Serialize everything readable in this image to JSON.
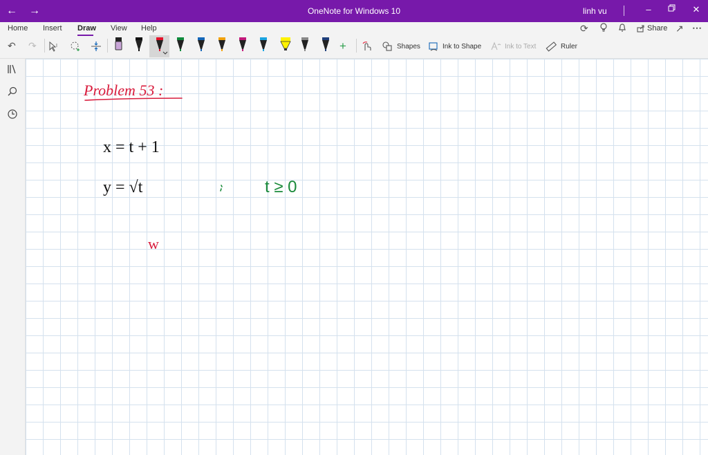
{
  "titlebar": {
    "title": "OneNote for Windows 10",
    "user": "linh vu",
    "back_icon": "arrow-left",
    "forward_icon": "arrow-right",
    "controls": [
      "minimize",
      "restore",
      "close"
    ],
    "color": "#7719aa"
  },
  "ribbon": {
    "tabs": [
      {
        "label": "Home"
      },
      {
        "label": "Insert"
      },
      {
        "label": "Draw",
        "active": true
      },
      {
        "label": "View"
      },
      {
        "label": "Help"
      }
    ],
    "share_label": "Share",
    "tools": {
      "shapes_label": "Shapes",
      "ink_to_shape_label": "Ink to Shape",
      "ink_to_text_label": "Ink to Text",
      "ruler_label": "Ruler"
    },
    "pens": [
      {
        "name": "eraser",
        "color": "#c9a6d8"
      },
      {
        "name": "pen-black",
        "color": "#111111"
      },
      {
        "name": "pen-red",
        "color": "#e3122b",
        "selected": true
      },
      {
        "name": "pen-green",
        "color": "#0f8a3c"
      },
      {
        "name": "pen-blue",
        "color": "#1466b8"
      },
      {
        "name": "pen-orange",
        "color": "#f2a20c"
      },
      {
        "name": "pen-magenta",
        "color": "#c2187a"
      },
      {
        "name": "pen-cyan",
        "color": "#1aa3e0"
      },
      {
        "name": "highlighter-yellow",
        "color": "#fff200"
      },
      {
        "name": "pencil-gray",
        "color": "#888888"
      },
      {
        "name": "pen-navy",
        "color": "#1f3f7a"
      }
    ]
  },
  "sidebar": {
    "icons": [
      "notebooks-icon",
      "search-icon",
      "recent-icon"
    ]
  },
  "canvas": {
    "ink": [
      {
        "text": "Problem 53 :",
        "color": "#d81b3c"
      },
      {
        "text": "x = t + 1",
        "color": "#111111"
      },
      {
        "text": "y = √t",
        "color": "#111111"
      },
      {
        "text": "t ≥ 0",
        "color": "#1a8a3a"
      },
      {
        "text": "w",
        "color": "#d81b3c"
      }
    ]
  }
}
